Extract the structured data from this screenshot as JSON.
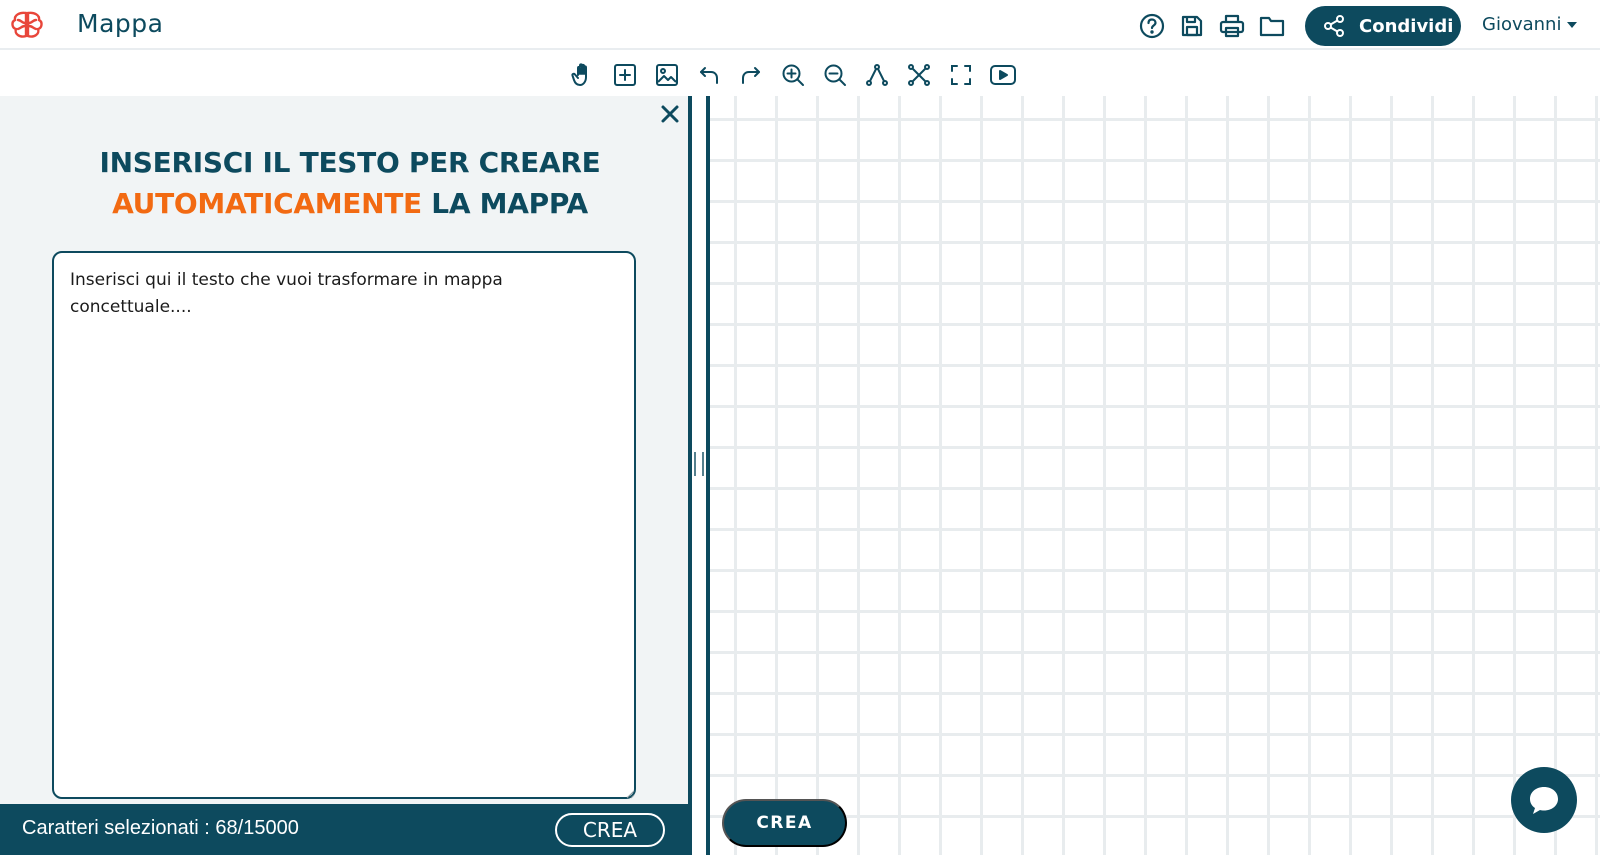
{
  "header": {
    "title": "Mappa",
    "logo_icon": "brain-icon",
    "icons": [
      "help-icon",
      "save-icon",
      "print-icon",
      "folder-icon"
    ],
    "share_label": "Condividi",
    "user_name": "Giovanni"
  },
  "toolbar": {
    "tools": [
      "hand-icon",
      "add-node-icon",
      "image-icon",
      "undo-icon",
      "redo-icon",
      "zoom-in-icon",
      "zoom-out-icon",
      "connector-icon",
      "fit-nodes-icon",
      "fullscreen-icon",
      "presentation-icon"
    ]
  },
  "panel": {
    "heading_line1": "INSERISCI IL TESTO PER CREARE",
    "heading_accent": "AUTOMATICAMENTE",
    "heading_rest": " LA MAPPA",
    "textarea_placeholder": "Inserisci qui il testo che vuoi trasformare in mappa concettuale....",
    "char_count": "Caratteri selezionati : 68/15000",
    "create_label": "CREA"
  },
  "canvas": {
    "create_label": "CREA"
  },
  "colors": {
    "primary": "#0d4a5e",
    "accent": "#f26a12",
    "logo": "#e8463a",
    "panel_bg": "#f1f4f5",
    "grid": "#e8ecee"
  }
}
